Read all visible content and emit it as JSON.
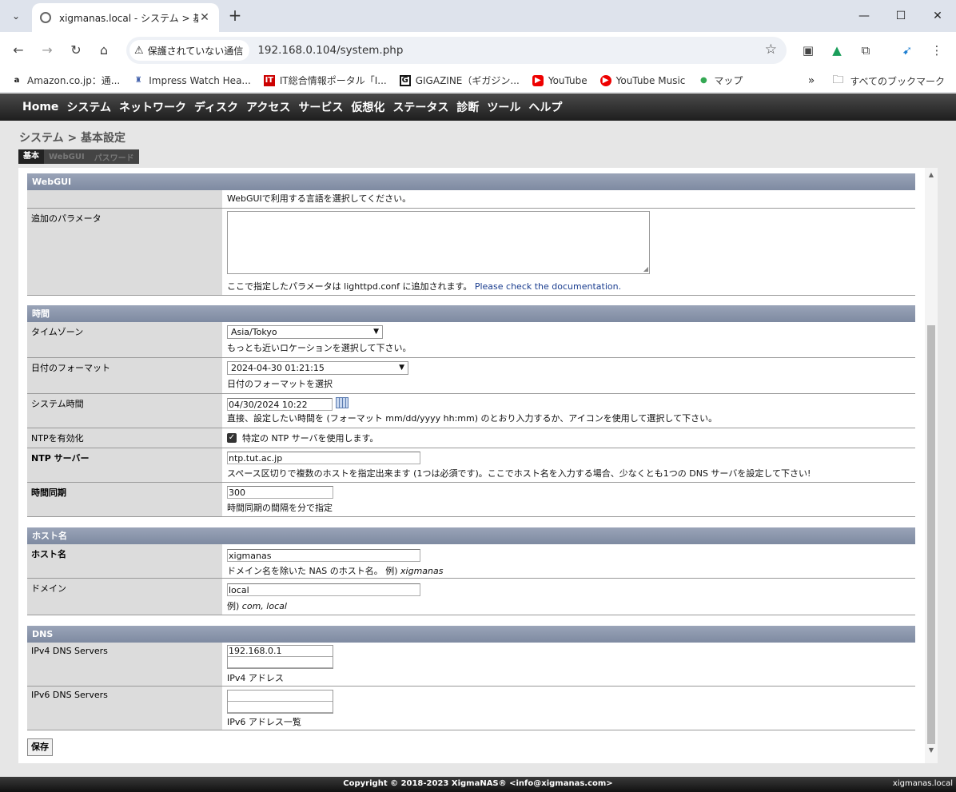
{
  "browser": {
    "tab_title": "xigmanas.local - システム > 基本設",
    "tab_close": "✕",
    "new_tab": "+",
    "security_label": "保護されていない通信",
    "url": "192.168.0.104/system.php",
    "bookmarks": [
      "Amazon.co.jp：通...",
      "Impress Watch Hea...",
      "IT総合情報ポータル「I...",
      "GIGAZINE（ギガジン...",
      "YouTube",
      "YouTube Music",
      "マップ"
    ],
    "all_bookmarks": "すべてのブックマーク"
  },
  "nav": [
    "Home",
    "システム",
    "ネットワーク",
    "ディスク",
    "アクセス",
    "サービス",
    "仮想化",
    "ステータス",
    "診断",
    "ツール",
    "ヘルプ"
  ],
  "breadcrumb": "システム > 基本設定",
  "subtabs": [
    "基本",
    "WebGUI",
    "パスワード"
  ],
  "webgui": {
    "header": "WebGUI",
    "lang_note": "WebGUIで利用する言語を選択してください。",
    "extra_params_label": "追加のパラメータ",
    "extra_params_note": "ここで指定したパラメータは lighttpd.conf に追加されます。",
    "doc_link": "Please check the documentation."
  },
  "time": {
    "header": "時間",
    "timezone_label": "タイムゾーン",
    "timezone_value": "Asia/Tokyo",
    "timezone_note": "もっとも近いロケーションを選択して下さい。",
    "datefmt_label": "日付のフォーマット",
    "datefmt_value": "2024-04-30 01:21:15",
    "datefmt_note": "日付のフォーマットを選択",
    "systime_label": "システム時間",
    "systime_value": "04/30/2024 10:22",
    "systime_note": "直接、設定したい時間を (フォーマット mm/dd/yyyy hh:mm) のとおり入力するか、アイコンを使用して選択して下さい。",
    "ntp_enable_label": "NTPを有効化",
    "ntp_enable_note": "特定の NTP サーバを使用します。",
    "ntp_server_label": "NTP サーバー",
    "ntp_server_value": "ntp.tut.ac.jp",
    "ntp_server_note": "スペース区切りで複数のホストを指定出来ます (1つは必須です)。ここでホスト名を入力する場合、少なくとも1つの DNS サーバを設定して下さい!",
    "sync_label": "時間同期",
    "sync_value": "300",
    "sync_note": "時間同期の間隔を分で指定"
  },
  "hostname": {
    "header": "ホスト名",
    "host_label": "ホスト名",
    "host_value": "xigmanas",
    "host_note": "ドメイン名を除いた NAS のホスト名。 例)",
    "host_example": "xigmanas",
    "domain_label": "ドメイン",
    "domain_value": "local",
    "domain_note": "例)",
    "domain_example": "com, local"
  },
  "dns": {
    "header": "DNS",
    "ipv4_label": "IPv4 DNS Servers",
    "ipv4_values": [
      "192.168.0.1",
      ""
    ],
    "ipv4_note": "IPv4 アドレス",
    "ipv6_label": "IPv6 DNS Servers",
    "ipv6_values": [
      "",
      ""
    ],
    "ipv6_note": "IPv6 アドレス一覧"
  },
  "save_label": "保存",
  "footer": {
    "copyright": "Copyright © 2018-2023 XigmaNAS® <info@xigmanas.com>",
    "host": "xigmanas.local"
  }
}
